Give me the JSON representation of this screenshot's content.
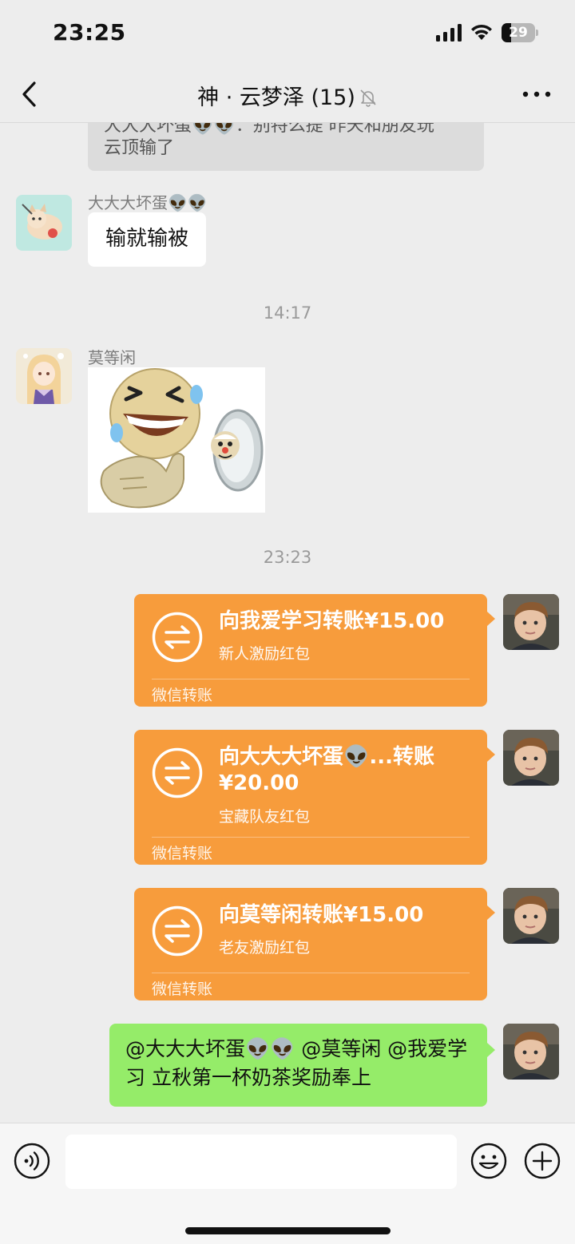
{
  "status_bar": {
    "time": "23:25",
    "battery": "29",
    "battery_level": 0.29
  },
  "header": {
    "title": "神 · 云梦泽 (15)",
    "back_icon": "chevron-left-icon",
    "mute_icon": "bell-slash-icon",
    "more_icon": "ellipsis-icon"
  },
  "messages": {
    "prev_text_line1": "大大大坏蛋👽👽：别特么提 昨天和朋友玩",
    "prev_text_line2": "云顶输了",
    "msg1_sender": "大大大坏蛋👽👽",
    "msg1_text": "输就输被",
    "time1": "14:17",
    "msg2_sender": "莫等闲",
    "sticker": "laughing-pointing-emoji-sticker",
    "time2": "23:23",
    "transfer1": {
      "title": "向我爱学习转账¥15.00",
      "subtitle": "新人激励红包",
      "footer": "微信转账"
    },
    "transfer2": {
      "title": "向大大大坏蛋👽...转账¥20.00",
      "subtitle": "宝藏队友红包",
      "footer": "微信转账"
    },
    "transfer3": {
      "title": "向莫等闲转账¥15.00",
      "subtitle": "老友激励红包",
      "footer": "微信转账"
    },
    "outgoing_text": "@大大大坏蛋👽👽 @莫等闲 @我爱学习 立秋第一杯奶茶奖励奉上"
  },
  "input_bar": {
    "voice_icon": "voice-icon",
    "emoji_icon": "smile-icon",
    "plus_icon": "plus-circle-icon",
    "placeholder": ""
  },
  "colors": {
    "background": "#ededed",
    "transfer": "#f79c3c",
    "outgoing": "#95ec69",
    "incoming": "#ffffff"
  }
}
